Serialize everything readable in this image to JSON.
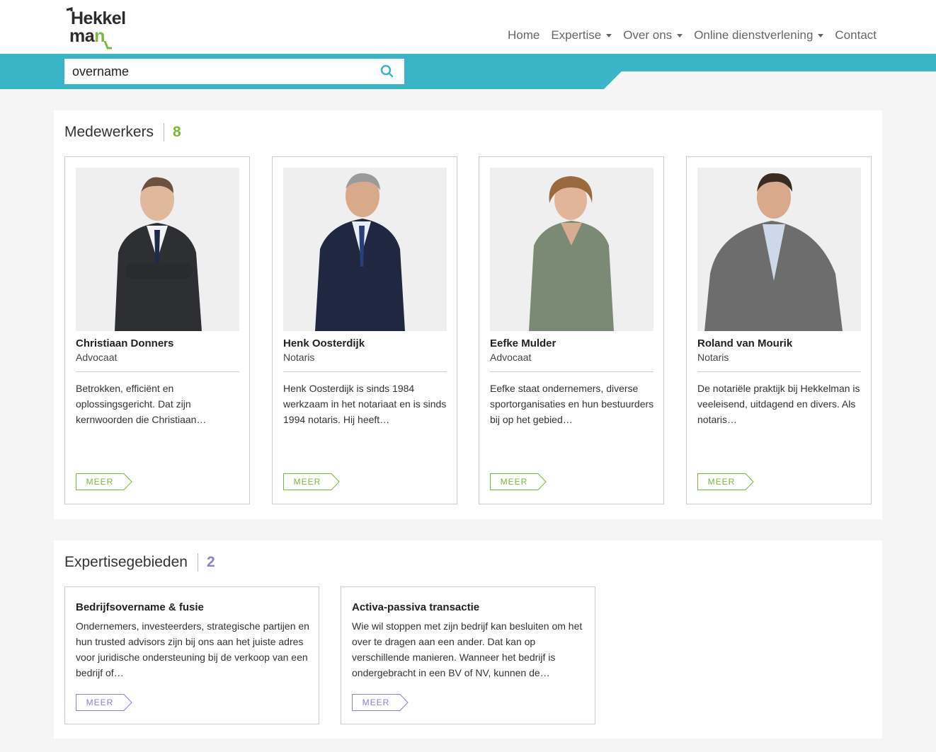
{
  "logo": {
    "line1": "Hekkel",
    "line2_a": "ma",
    "line2_b": "n"
  },
  "nav": [
    {
      "label": "Home",
      "dropdown": false
    },
    {
      "label": "Expertise",
      "dropdown": true
    },
    {
      "label": "Over ons",
      "dropdown": true
    },
    {
      "label": "Online dienstverlening",
      "dropdown": true
    },
    {
      "label": "Contact",
      "dropdown": false
    }
  ],
  "search": {
    "value": "overname",
    "icon": "search-icon"
  },
  "colors": {
    "teal": "#3ab5c7",
    "green": "#7cb73a",
    "purple": "#8a7fd0"
  },
  "medewerkers": {
    "title": "Medewerkers",
    "count": "8",
    "people": [
      {
        "name": "Christiaan Donners",
        "role": "Advocaat",
        "description": "Betrokken, efficiënt en oplossingsgericht. Dat zijn kernwoorden die Christiaan…",
        "button": "MEER"
      },
      {
        "name": "Henk Oosterdijk",
        "role": "Notaris",
        "description": "Henk Oosterdijk is sinds 1984 werkzaam in het notariaat en is sinds 1994 notaris. Hij heeft…",
        "button": "MEER"
      },
      {
        "name": "Eefke Mulder",
        "role": "Advocaat",
        "description": "Eefke staat ondernemers, diverse sportorganisaties en hun bestuurders bij op het gebied…",
        "button": "MEER"
      },
      {
        "name": "Roland van Mourik",
        "role": "Notaris",
        "description": "De notariële praktijk bij Hekkelman is veeleisend, uitdagend en divers. Als notaris…",
        "button": "MEER"
      }
    ]
  },
  "expertise": {
    "title": "Expertisegebieden",
    "count": "2",
    "items": [
      {
        "title": "Bedrijfsovername & fusie",
        "description": "Ondernemers, investeerders, strategische partijen en hun trusted advisors zijn bij ons aan het juiste adres voor juridische ondersteuning bij de verkoop van een bedrijf of…",
        "button": "MEER"
      },
      {
        "title": "Activa-passiva transactie",
        "description": "Wie wil stoppen met zijn bedrijf kan besluiten om het over te dragen aan een ander. Dat kan op verschillende manieren. Wanneer het bedrijf is ondergebracht in een BV of NV, kunnen de…",
        "button": "MEER"
      }
    ]
  }
}
